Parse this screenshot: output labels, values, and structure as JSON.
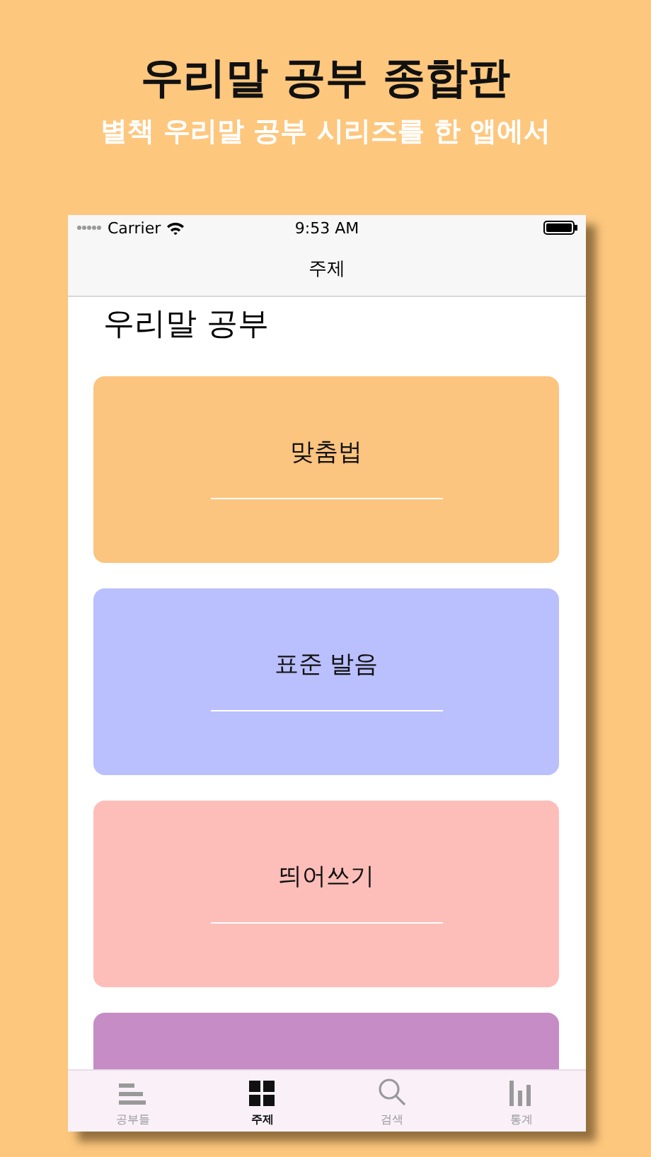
{
  "header": {
    "title": "우리말 공부 종합판",
    "subtitle": "별책 우리말 공부 시리즈를 한 앱에서"
  },
  "status_bar": {
    "carrier": "Carrier",
    "time": "9:53 AM"
  },
  "nav_title": "주제",
  "section_title": "우리말 공부",
  "cards": [
    {
      "label": "맞춤법",
      "color": "#fbc47f"
    },
    {
      "label": "표준 발음",
      "color": "#babffd"
    },
    {
      "label": "띄어쓰기",
      "color": "#fdbeb9"
    },
    {
      "color": "#c68cc5"
    }
  ],
  "tabs": [
    {
      "label": "공부들",
      "selected": false
    },
    {
      "label": "주제",
      "selected": true
    },
    {
      "label": "검색",
      "selected": false
    },
    {
      "label": "통계",
      "selected": false
    }
  ]
}
